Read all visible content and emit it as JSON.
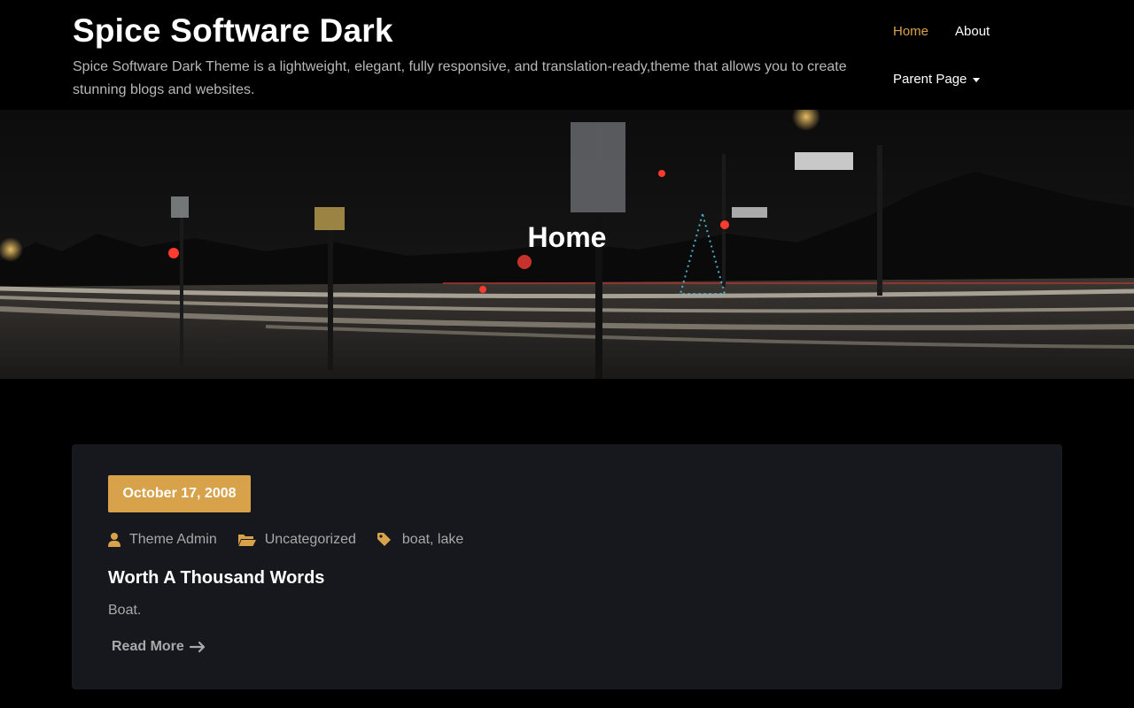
{
  "site": {
    "title": "Spice Software Dark",
    "description": "Spice Software Dark Theme is a lightweight, elegant, fully responsive, and translation-ready,theme that allows you to create stunning blogs and websites."
  },
  "nav": {
    "items": [
      {
        "label": "Home",
        "active": true
      },
      {
        "label": "About",
        "active": false
      },
      {
        "label": "Parent Page",
        "active": false,
        "has_dropdown": true
      }
    ]
  },
  "hero": {
    "title": "Home"
  },
  "post": {
    "date": "October 17, 2008",
    "author": "Theme Admin",
    "category": "Uncategorized",
    "tags": "boat, lake",
    "title": "Worth A Thousand Words",
    "excerpt": "Boat.",
    "read_more": "Read More"
  },
  "colors": {
    "accent": "#d8a24a",
    "background": "#000000",
    "card": "#17181d"
  },
  "icons": {
    "author": "user-icon",
    "category": "folder-open-icon",
    "tags": "tag-icon",
    "read_more": "arrow-right-icon"
  }
}
